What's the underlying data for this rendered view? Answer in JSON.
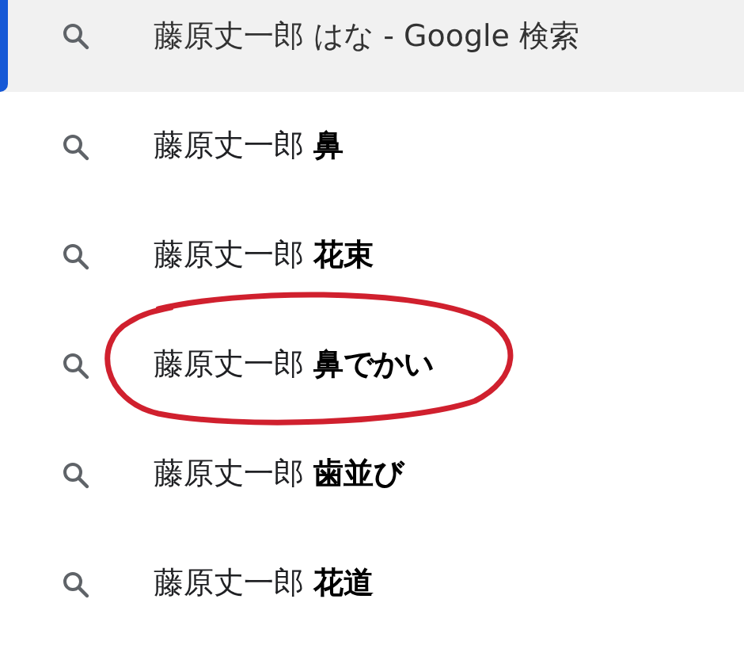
{
  "suggestions": [
    {
      "text": "藤原丈一郎 はな - Google 検索",
      "selected": true,
      "circled": false
    },
    {
      "text": "藤原丈一郎 **鼻**",
      "selected": false,
      "circled": false
    },
    {
      "text": "藤原丈一郎 **花束**",
      "selected": false,
      "circled": false
    },
    {
      "text": "藤原丈一郎 **鼻でかい**",
      "selected": false,
      "circled": true
    },
    {
      "text": "藤原丈一郎 **歯並び**",
      "selected": false,
      "circled": false
    },
    {
      "text": "藤原丈一郎 **花道**",
      "selected": false,
      "circled": false
    }
  ]
}
